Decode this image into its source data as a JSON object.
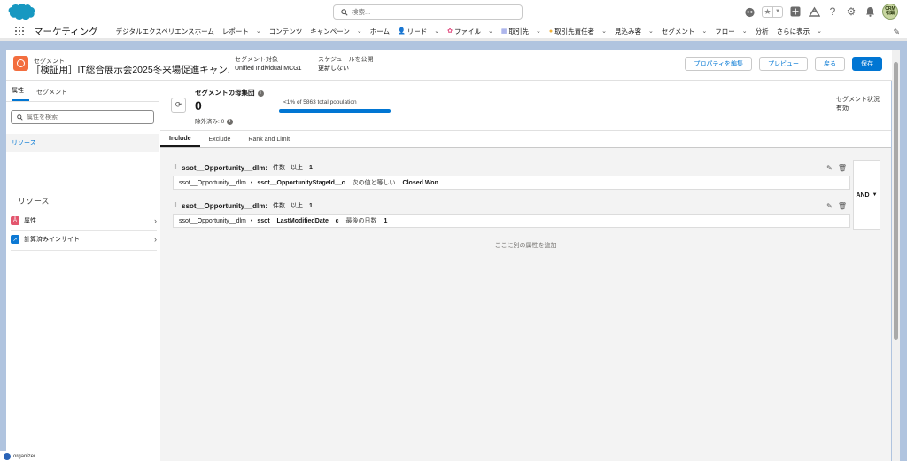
{
  "header": {
    "search_placeholder": "検索...",
    "avatar_line1": "CRM",
    "avatar_line2": "石鍋"
  },
  "nav": {
    "app_name": "マーケティング",
    "items": [
      {
        "label": "デジタルエクスペリエンスホーム",
        "chevron": false
      },
      {
        "label": "レポート",
        "chevron": true
      },
      {
        "label": "コンテンツ",
        "chevron": false
      },
      {
        "label": "キャンペーン",
        "chevron": true
      },
      {
        "label": "ホーム",
        "chevron": false
      },
      {
        "label": "リード",
        "chevron": true,
        "icon": "person-icon"
      },
      {
        "label": "ファイル",
        "chevron": true,
        "icon": "star-icon"
      },
      {
        "label": "取引先",
        "chevron": true,
        "icon": "account-icon"
      },
      {
        "label": "取引先責任者",
        "chevron": true,
        "icon": "contact-icon"
      },
      {
        "label": "見込み客",
        "chevron": true
      },
      {
        "label": "セグメント",
        "chevron": true
      },
      {
        "label": "フロー",
        "chevron": true
      },
      {
        "label": "分析",
        "chevron": false
      },
      {
        "label": "さらに表示",
        "chevron": true
      }
    ]
  },
  "record": {
    "object_type": "セグメント",
    "title": "［検証用］IT総合展示会2025冬来場促進キャン...",
    "target_label": "セグメント対象",
    "target_value": "Unified Individual MCG1",
    "schedule_label": "スケジュールを公開",
    "schedule_value": "更新しない",
    "buttons": {
      "edit_props": "プロパティを編集",
      "preview": "プレビュー",
      "back": "戻る",
      "save": "保存"
    }
  },
  "left": {
    "tabs": [
      "属性",
      "セグメント"
    ],
    "search_placeholder": "属性を検索",
    "section": "リソース",
    "subheading": "リソース",
    "items": [
      {
        "label": "属性"
      },
      {
        "label": "計算済みインサイト"
      }
    ]
  },
  "population": {
    "title": "セグメントの母集団",
    "count": "0",
    "excluded": "除外済み: 0",
    "percent_label": "<1% of 5863 total population",
    "status_label": "セグメント状況",
    "status_value": "有効"
  },
  "tabs": [
    "Include",
    "Exclude",
    "Rank and Limit"
  ],
  "rules": [
    {
      "title": "ssot__Opportunity__dlm:",
      "op_label": "件数",
      "op": "以上",
      "num": "1",
      "cond_object": "ssot__Opportunity__dlm",
      "cond_sep": "•",
      "cond_field": "ssot__OpportunityStageId__c",
      "cond_op": "次の値と等しい",
      "cond_value": "Closed Won"
    },
    {
      "title": "ssot__Opportunity__dlm:",
      "op_label": "件数",
      "op": "以上",
      "num": "1",
      "cond_object": "ssot__Opportunity__dlm",
      "cond_sep": "•",
      "cond_field": "ssot__LastModifiedDate__c",
      "cond_op": "最後の日数",
      "cond_value": "1"
    }
  ],
  "logic_operator": "AND",
  "add_attribute_hint": "ここに別の属性を追加",
  "utility": {
    "label": "organizer"
  },
  "colors": {
    "brand": "#0176d3",
    "segment_icon": "#f36e3f"
  }
}
